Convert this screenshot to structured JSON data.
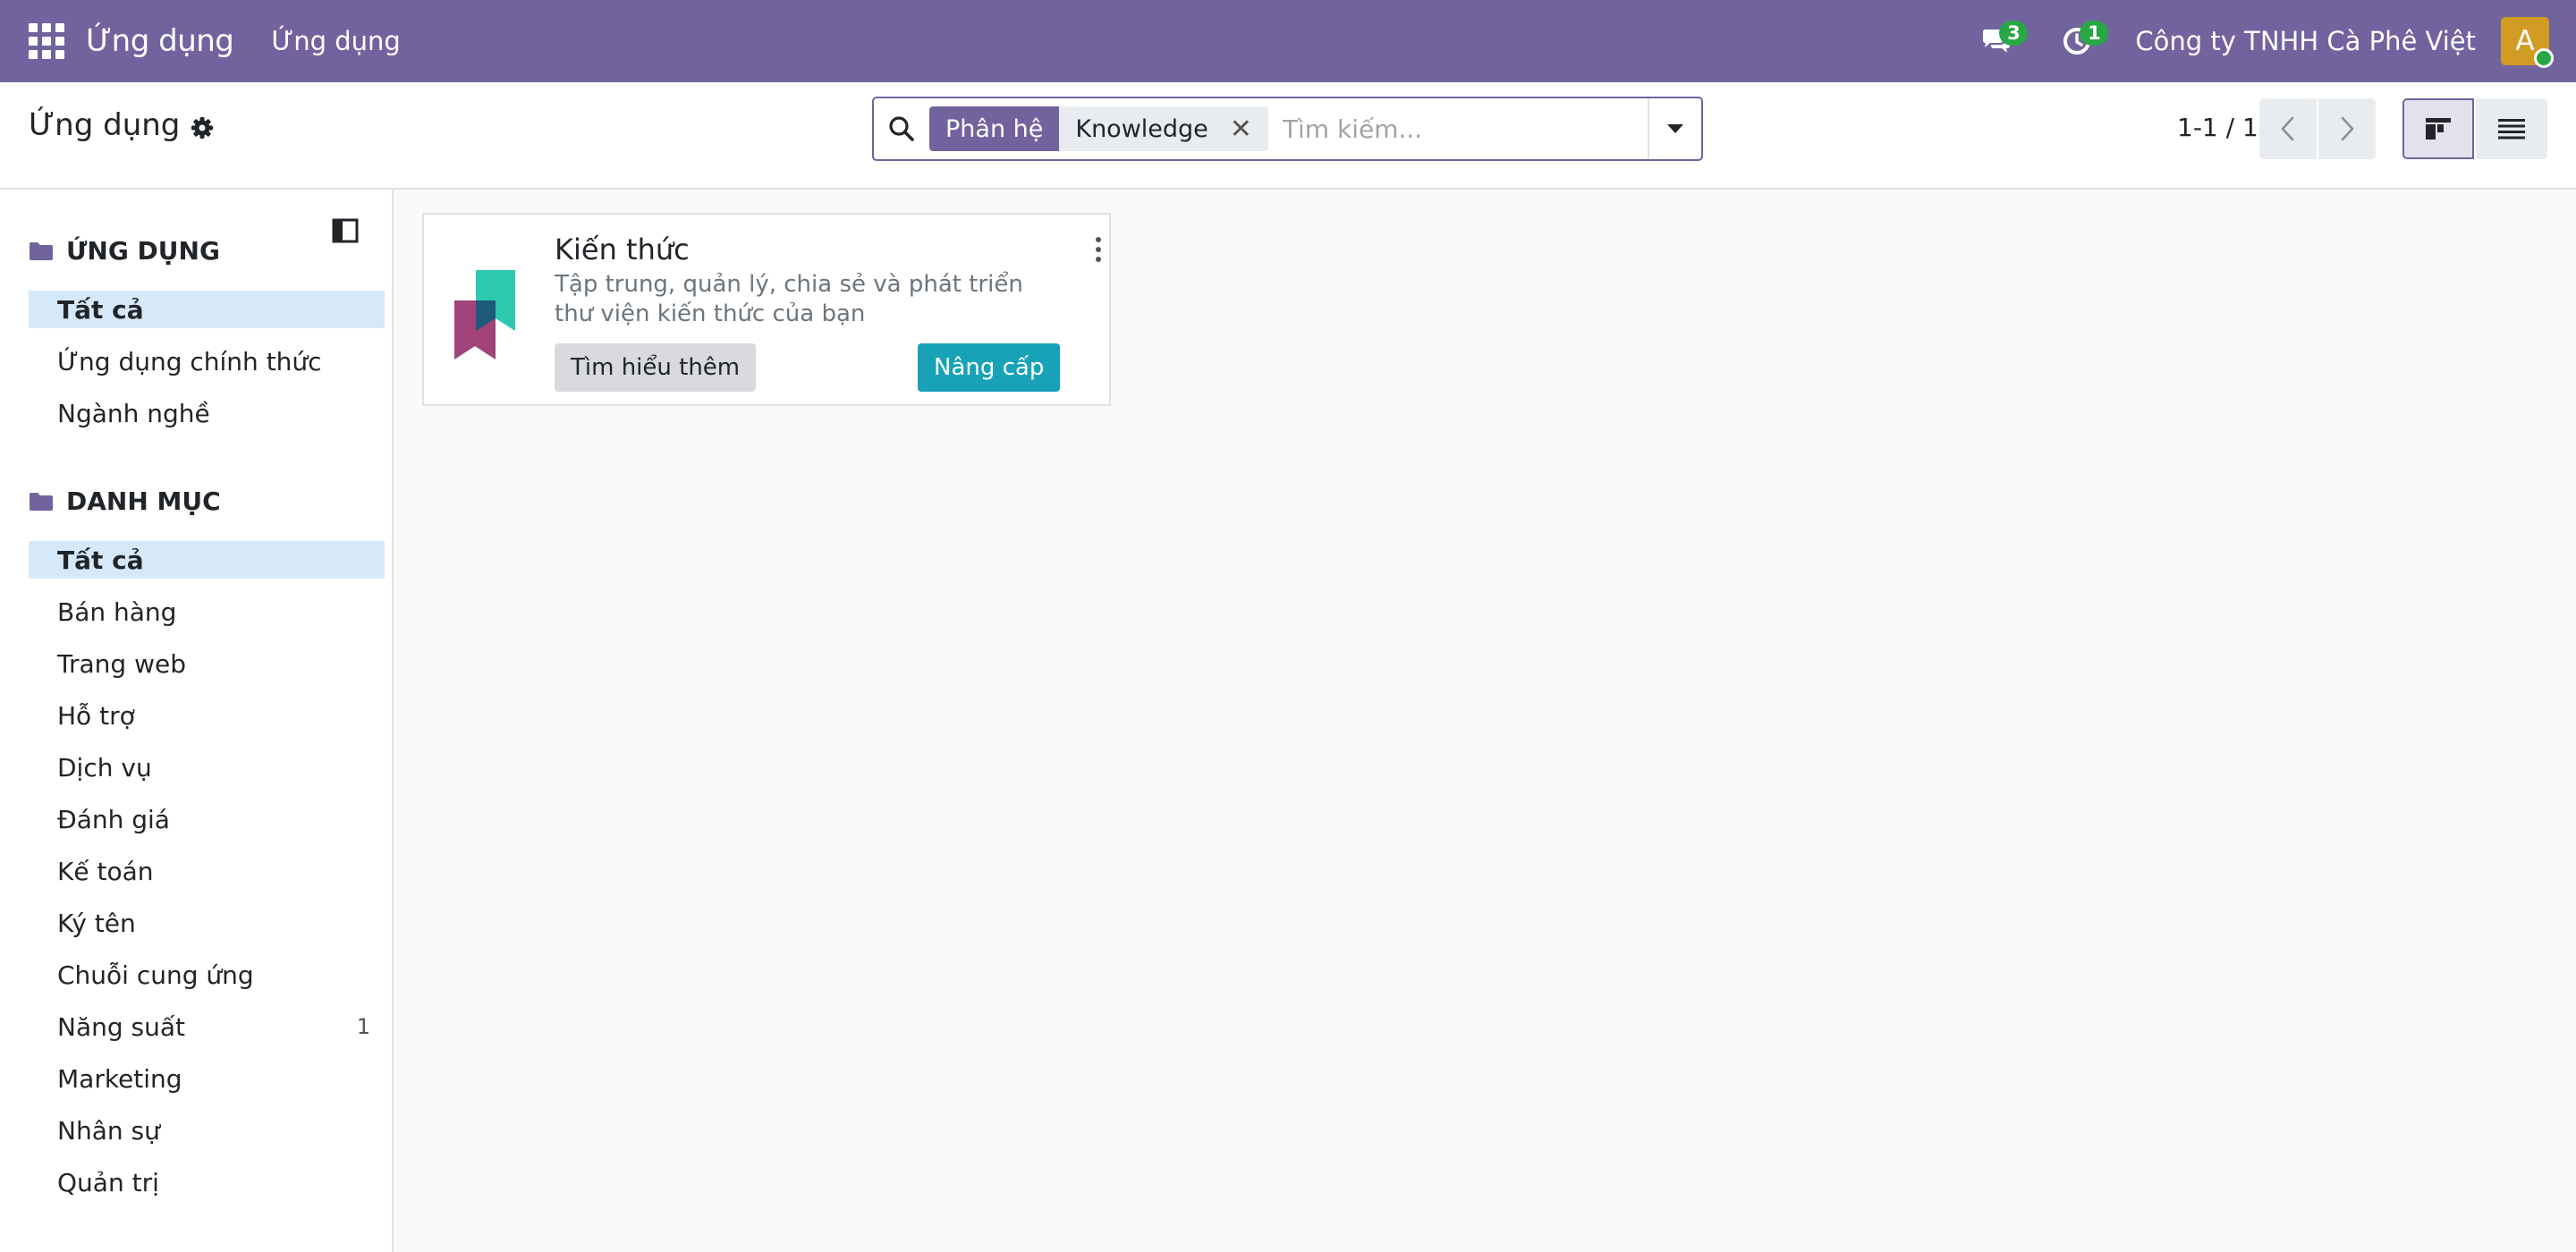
{
  "navbar": {
    "brand": "Ứng dụng",
    "menu_item": "Ứng dụng",
    "messages_count": "3",
    "activities_count": "1",
    "company": "Công ty TNHH Cà Phê Việt",
    "avatar_initial": "A",
    "color": "#71639e"
  },
  "control_panel": {
    "title": "Ứng dụng",
    "search": {
      "facet_label": "Phân hệ",
      "facet_value": "Knowledge",
      "facet_remove": "✕",
      "placeholder": "Tìm kiếm..."
    },
    "pager": "1-1 / 1"
  },
  "sidebar": {
    "apps_section": {
      "title": "ỨNG DỤNG",
      "items": [
        {
          "label": "Tất cả"
        },
        {
          "label": "Ứng dụng chính thức"
        },
        {
          "label": "Ngành nghề"
        }
      ]
    },
    "category_section": {
      "title": "DANH MỤC",
      "items": [
        {
          "label": "Tất cả"
        },
        {
          "label": "Bán hàng"
        },
        {
          "label": "Trang web"
        },
        {
          "label": "Hỗ trợ"
        },
        {
          "label": "Dịch vụ"
        },
        {
          "label": "Đánh giá"
        },
        {
          "label": "Kế toán"
        },
        {
          "label": "Ký tên"
        },
        {
          "label": "Chuỗi cung ứng"
        },
        {
          "label": "Năng suất",
          "count": "1"
        },
        {
          "label": "Marketing"
        },
        {
          "label": "Nhân sự"
        },
        {
          "label": "Quản trị"
        }
      ]
    }
  },
  "card": {
    "title": "Kiến thức",
    "description": "Tập trung, quản lý, chia sẻ và phát triển thư viện kiến thức của bạn",
    "learn_button": "Tìm hiểu thêm",
    "upgrade_button": "Nâng cấp",
    "upgrade_color": "#17a2b8"
  }
}
